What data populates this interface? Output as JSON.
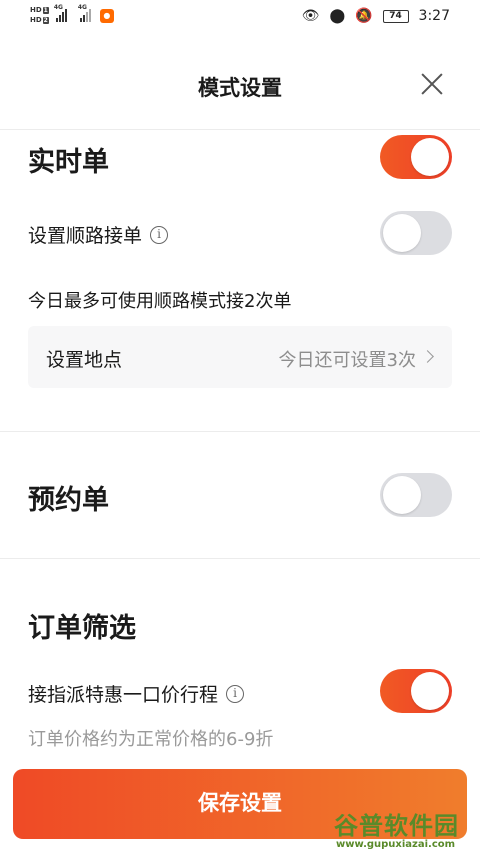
{
  "status_bar": {
    "hd1": "HD",
    "hd1_num": "1",
    "hd2": "HD",
    "hd2_num": "2",
    "net1": "4G",
    "net2": "4G",
    "battery": "74",
    "time": "3:27"
  },
  "header": {
    "title": "模式设置"
  },
  "realtime": {
    "title": "实时单",
    "enabled": true,
    "route_label": "设置顺路接单",
    "route_enabled": false,
    "route_limit_text": "今日最多可使用顺路模式接2次单",
    "location_label": "设置地点",
    "location_value": "今日还可设置3次"
  },
  "reservation": {
    "title": "预约单",
    "enabled": false
  },
  "filter": {
    "title": "订单筛选",
    "special_label": "接指派特惠一口价行程",
    "special_enabled": true,
    "special_hint": "订单价格约为正常价格的6-9折"
  },
  "footer": {
    "save_label": "保存设置"
  },
  "watermark": {
    "main": "谷普软件园",
    "sub": "www.gupuxiazai.com"
  },
  "colors": {
    "accent": "#EF4A26",
    "toggle_off": "#DCDDE1",
    "watermark": "#5A8A2A"
  }
}
